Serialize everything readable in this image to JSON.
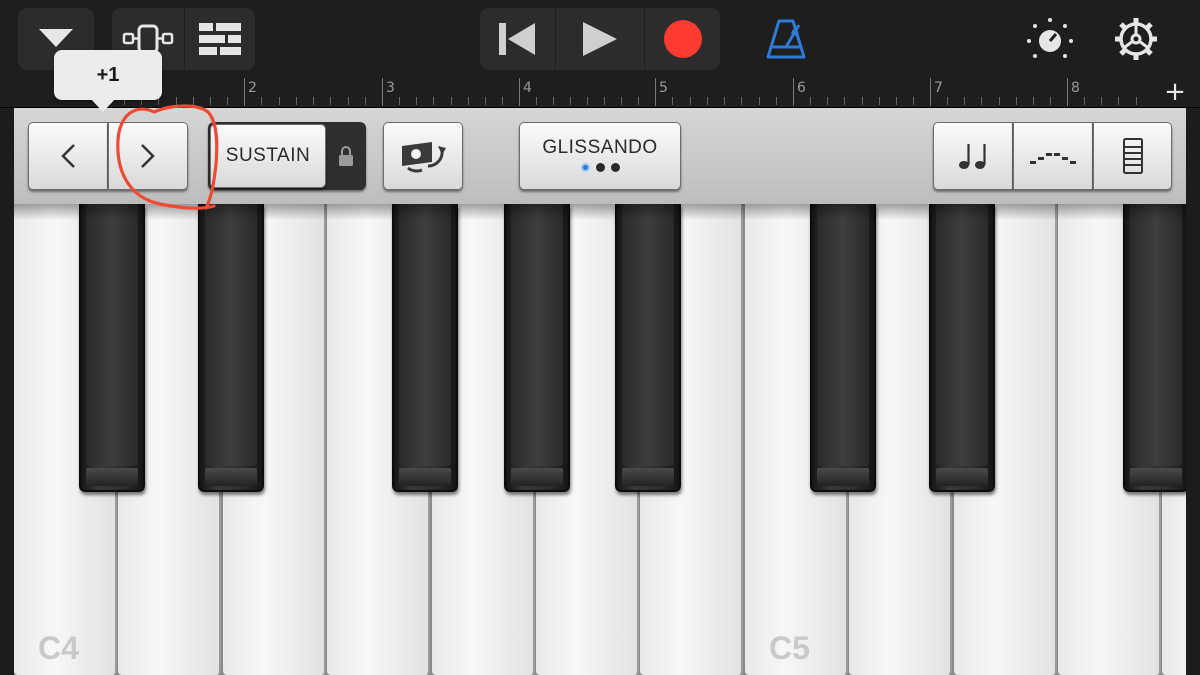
{
  "toolbar": {
    "menu_icon": "triangle-down-icon",
    "view_icon": "instrument-view-icon",
    "tracks_icon": "tracks-view-icon",
    "rewind_icon": "go-to-beginning-icon",
    "play_icon": "play-icon",
    "record_icon": "record-icon",
    "metronome_icon": "metronome-icon",
    "knob_icon": "master-effects-knob-icon",
    "settings_icon": "gear-icon",
    "record_color": "#ff3b30",
    "metronome_color": "#2e7bd6"
  },
  "ruler": {
    "bars": [
      "2",
      "3",
      "4",
      "5",
      "6",
      "7",
      "8"
    ],
    "add_label": "+"
  },
  "controls": {
    "octave_down_icon": "chevron-left-icon",
    "octave_up_icon": "chevron-right-icon",
    "sustain_label": "SUSTAIN",
    "lock_icon": "lock-icon",
    "autoplay_icon": "autoplay-icon",
    "glissando_label": "GLISSANDO",
    "glissando_dots": 3,
    "glissando_active_dot": 0,
    "notes_icon": "notes-icon",
    "arpeggiator_icon": "arpeggiator-icon",
    "keysize_icon": "key-size-icon"
  },
  "tooltip": {
    "text": "+1"
  },
  "annotation": {
    "color": "#ef4a34"
  },
  "keyboard": {
    "white_keys": [
      "C4",
      "",
      "",
      "",
      "",
      "",
      "",
      "C5",
      "",
      "",
      "",
      ""
    ],
    "c4_label": "C4",
    "c5_label": "C5"
  }
}
